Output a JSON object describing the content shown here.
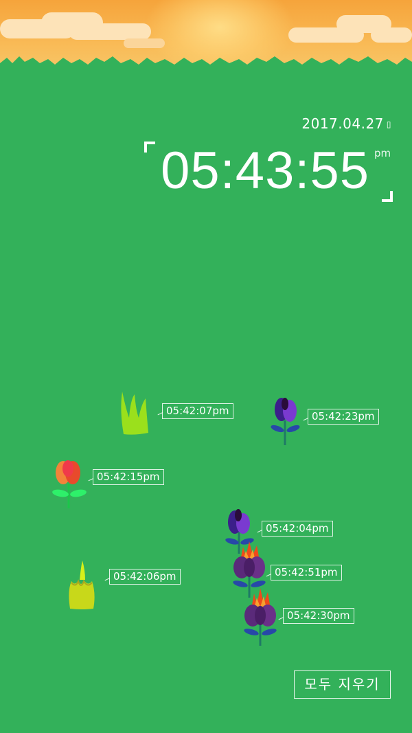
{
  "header": {
    "date": "2017.04.27",
    "date_icon": "calendar-icon",
    "time": "05:43:55",
    "ampm": "pm"
  },
  "plants": [
    {
      "kind": "grass",
      "timestamp": "05:42:07pm"
    },
    {
      "kind": "purple-tulip",
      "timestamp": "05:42:23pm"
    },
    {
      "kind": "red-tulip",
      "timestamp": "05:42:15pm"
    },
    {
      "kind": "purple-tulip",
      "timestamp": "05:42:04pm"
    },
    {
      "kind": "flame-flower",
      "timestamp": "05:42:51pm"
    },
    {
      "kind": "yellow-grass",
      "timestamp": "05:42:06pm"
    },
    {
      "kind": "flame-flower",
      "timestamp": "05:42:30pm"
    }
  ],
  "actions": {
    "clear_all_label": "모두 지우기"
  },
  "colors": {
    "background": "#33b15a",
    "sky": "#f6a43b"
  }
}
